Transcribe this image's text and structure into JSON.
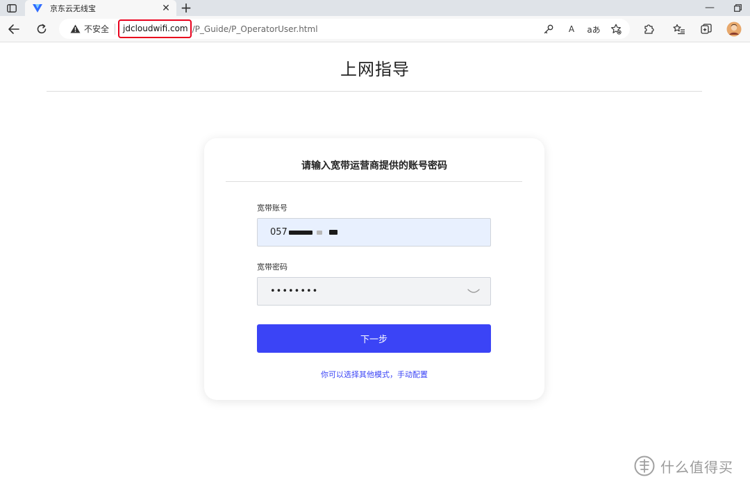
{
  "browser": {
    "tab": {
      "title": "京东云无线宝",
      "close_label": "✕"
    },
    "new_tab_label": "+",
    "window_minimize_label": "—",
    "address": {
      "security_text": "不安全",
      "host": "jdcloudwifi.com",
      "path": "/P_Guide/P_OperatorUser.html"
    },
    "read_aloud_label": "A",
    "translate_label": "aあ"
  },
  "page": {
    "title": "上网指导",
    "card": {
      "heading": "请输入宽带运营商提供的账号密码",
      "account_label": "宽带账号",
      "account_value_visible": "057",
      "password_label": "宽带密码",
      "password_value": "••••••••",
      "next_button": "下一步",
      "manual_link": "你可以选择其他模式，手动配置"
    }
  },
  "watermark": {
    "text": "什么值得买"
  },
  "colors": {
    "primary": "#3b44f6",
    "highlight_box": "#e8001c",
    "account_field_bg": "#e8f0fe",
    "password_field_bg": "#f2f3f5"
  },
  "icons": {
    "tab_actions": "tab-actions-icon",
    "favicon": "jd-favicon-icon",
    "back": "back-arrow-icon",
    "refresh": "refresh-icon",
    "warning": "warning-icon",
    "key": "key-icon",
    "read_aloud": "read-aloud-icon",
    "translate": "translate-icon",
    "favorite": "favorite-star-icon",
    "extensions": "puzzle-icon",
    "favorites_list": "favorites-list-icon",
    "collections": "collections-icon",
    "profile": "avatar",
    "eye": "eye-closed-icon"
  }
}
